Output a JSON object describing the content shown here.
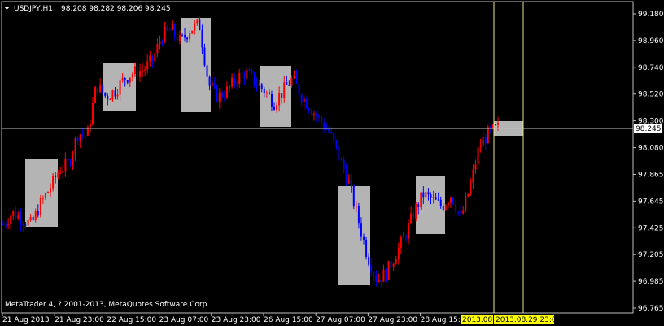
{
  "window": {
    "symbol_label": "USDJPY,H1",
    "ohlc_label": "98.208 98.282 98.206 98.245",
    "copyright": "MetaTrader 4, ? 2001-2013, MetaQuotes Software Corp.",
    "menu_icon": "triangle-down-icon"
  },
  "colors": {
    "background": "#000000",
    "up_candle": "#ff0000",
    "down_candle": "#0000ff",
    "highlight_box": "#b4b4b4",
    "grid_line": "#c0c0c0",
    "crosshair": "#f0e68c",
    "time_marker_bg": "#ffff00",
    "price_marker_bg": "#ffffff",
    "text": "#ffffff"
  },
  "price_axis": {
    "ticks": [
      "99.180",
      "98.960",
      "98.740",
      "98.520",
      "98.300",
      "98.080",
      "97.865",
      "97.645",
      "97.425",
      "97.205",
      "96.985",
      "96.765"
    ],
    "current_price": "98.245"
  },
  "time_axis": {
    "ticks": [
      "21 Aug 2013",
      "21 Aug 23:00",
      "22 Aug 15:00",
      "23 Aug 07:00",
      "23 Aug 23:00",
      "26 Aug 15:00",
      "27 Aug 07:00",
      "27 Aug 23:00",
      "28 Aug 15:00"
    ],
    "highlight_date_1": "2013.08",
    "highlight_date_2": "2013.08.29 23:00"
  },
  "chart_data": {
    "type": "candlestick",
    "symbol": "USDJPY",
    "timeframe": "H1",
    "ylim": [
      96.765,
      99.18
    ],
    "path_prices": [
      97.45,
      97.55,
      97.5,
      97.45,
      97.62,
      97.75,
      97.9,
      97.95,
      98.2,
      98.18,
      98.6,
      98.5,
      98.55,
      98.65,
      98.7,
      98.72,
      98.8,
      99.0,
      99.05,
      98.95,
      99.05,
      99.1,
      98.6,
      98.5,
      98.55,
      98.65,
      98.7,
      98.62,
      98.55,
      98.45,
      98.55,
      98.65,
      98.5,
      98.4,
      98.3,
      98.2,
      98.0,
      97.8,
      97.5,
      97.2,
      97.0,
      97.05,
      97.2,
      97.35,
      97.55,
      97.7,
      97.65,
      97.6,
      97.7,
      97.5,
      97.75,
      98.1,
      98.2,
      98.245
    ]
  }
}
